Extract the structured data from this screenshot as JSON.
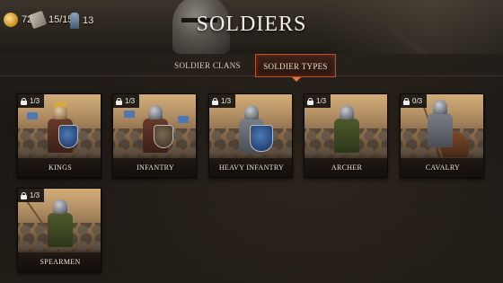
{
  "header": {
    "title": "SOLDIERS",
    "resources": {
      "gold": {
        "icon": "gold-coins-icon",
        "value": "720"
      },
      "food": {
        "icon": "food-icon",
        "value": "15/15"
      },
      "troops": {
        "icon": "soldier-icon",
        "value": "13"
      }
    }
  },
  "tabs": [
    {
      "label": "SOLDIER CLANS",
      "active": false
    },
    {
      "label": "SOLDIER TYPES",
      "active": true
    }
  ],
  "soldier_types": [
    {
      "name": "KINGS",
      "count": "1/3",
      "locked": true
    },
    {
      "name": "INFANTRY",
      "count": "1/3",
      "locked": true
    },
    {
      "name": "HEAVY INFANTRY",
      "count": "1/3",
      "locked": true
    },
    {
      "name": "ARCHER",
      "count": "1/3",
      "locked": true
    },
    {
      "name": "CAVALRY",
      "count": "0/3",
      "locked": true
    },
    {
      "name": "SPEARMEN",
      "count": "1/3",
      "locked": true
    }
  ],
  "colors": {
    "active_tab_border": "#c24b28",
    "background": "#17130f",
    "title_text": "#f4efe6"
  }
}
